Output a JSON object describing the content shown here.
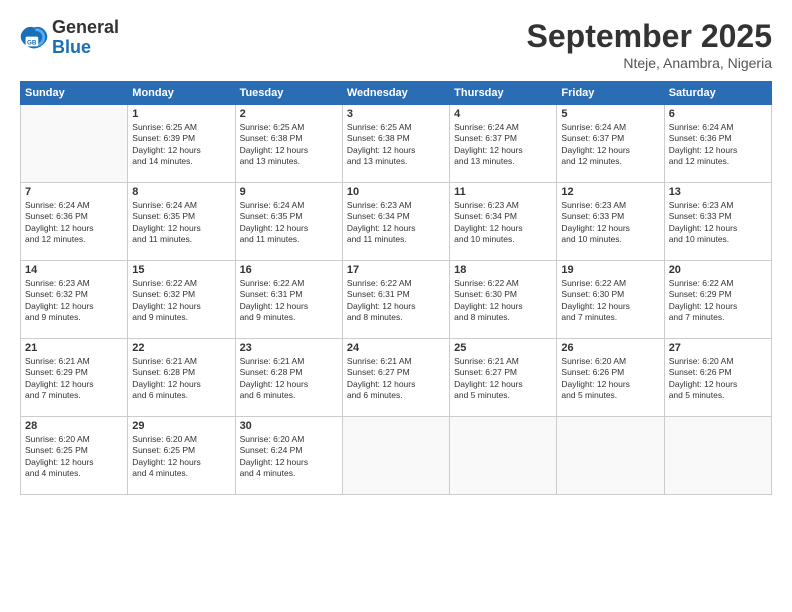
{
  "logo": {
    "text_general": "General",
    "text_blue": "Blue"
  },
  "title": "September 2025",
  "location": "Nteje, Anambra, Nigeria",
  "header_days": [
    "Sunday",
    "Monday",
    "Tuesday",
    "Wednesday",
    "Thursday",
    "Friday",
    "Saturday"
  ],
  "weeks": [
    [
      {
        "day": "",
        "info": ""
      },
      {
        "day": "1",
        "info": "Sunrise: 6:25 AM\nSunset: 6:39 PM\nDaylight: 12 hours\nand 14 minutes."
      },
      {
        "day": "2",
        "info": "Sunrise: 6:25 AM\nSunset: 6:38 PM\nDaylight: 12 hours\nand 13 minutes."
      },
      {
        "day": "3",
        "info": "Sunrise: 6:25 AM\nSunset: 6:38 PM\nDaylight: 12 hours\nand 13 minutes."
      },
      {
        "day": "4",
        "info": "Sunrise: 6:24 AM\nSunset: 6:37 PM\nDaylight: 12 hours\nand 13 minutes."
      },
      {
        "day": "5",
        "info": "Sunrise: 6:24 AM\nSunset: 6:37 PM\nDaylight: 12 hours\nand 12 minutes."
      },
      {
        "day": "6",
        "info": "Sunrise: 6:24 AM\nSunset: 6:36 PM\nDaylight: 12 hours\nand 12 minutes."
      }
    ],
    [
      {
        "day": "7",
        "info": "Sunrise: 6:24 AM\nSunset: 6:36 PM\nDaylight: 12 hours\nand 12 minutes."
      },
      {
        "day": "8",
        "info": "Sunrise: 6:24 AM\nSunset: 6:35 PM\nDaylight: 12 hours\nand 11 minutes."
      },
      {
        "day": "9",
        "info": "Sunrise: 6:24 AM\nSunset: 6:35 PM\nDaylight: 12 hours\nand 11 minutes."
      },
      {
        "day": "10",
        "info": "Sunrise: 6:23 AM\nSunset: 6:34 PM\nDaylight: 12 hours\nand 11 minutes."
      },
      {
        "day": "11",
        "info": "Sunrise: 6:23 AM\nSunset: 6:34 PM\nDaylight: 12 hours\nand 10 minutes."
      },
      {
        "day": "12",
        "info": "Sunrise: 6:23 AM\nSunset: 6:33 PM\nDaylight: 12 hours\nand 10 minutes."
      },
      {
        "day": "13",
        "info": "Sunrise: 6:23 AM\nSunset: 6:33 PM\nDaylight: 12 hours\nand 10 minutes."
      }
    ],
    [
      {
        "day": "14",
        "info": "Sunrise: 6:23 AM\nSunset: 6:32 PM\nDaylight: 12 hours\nand 9 minutes."
      },
      {
        "day": "15",
        "info": "Sunrise: 6:22 AM\nSunset: 6:32 PM\nDaylight: 12 hours\nand 9 minutes."
      },
      {
        "day": "16",
        "info": "Sunrise: 6:22 AM\nSunset: 6:31 PM\nDaylight: 12 hours\nand 9 minutes."
      },
      {
        "day": "17",
        "info": "Sunrise: 6:22 AM\nSunset: 6:31 PM\nDaylight: 12 hours\nand 8 minutes."
      },
      {
        "day": "18",
        "info": "Sunrise: 6:22 AM\nSunset: 6:30 PM\nDaylight: 12 hours\nand 8 minutes."
      },
      {
        "day": "19",
        "info": "Sunrise: 6:22 AM\nSunset: 6:30 PM\nDaylight: 12 hours\nand 7 minutes."
      },
      {
        "day": "20",
        "info": "Sunrise: 6:22 AM\nSunset: 6:29 PM\nDaylight: 12 hours\nand 7 minutes."
      }
    ],
    [
      {
        "day": "21",
        "info": "Sunrise: 6:21 AM\nSunset: 6:29 PM\nDaylight: 12 hours\nand 7 minutes."
      },
      {
        "day": "22",
        "info": "Sunrise: 6:21 AM\nSunset: 6:28 PM\nDaylight: 12 hours\nand 6 minutes."
      },
      {
        "day": "23",
        "info": "Sunrise: 6:21 AM\nSunset: 6:28 PM\nDaylight: 12 hours\nand 6 minutes."
      },
      {
        "day": "24",
        "info": "Sunrise: 6:21 AM\nSunset: 6:27 PM\nDaylight: 12 hours\nand 6 minutes."
      },
      {
        "day": "25",
        "info": "Sunrise: 6:21 AM\nSunset: 6:27 PM\nDaylight: 12 hours\nand 5 minutes."
      },
      {
        "day": "26",
        "info": "Sunrise: 6:20 AM\nSunset: 6:26 PM\nDaylight: 12 hours\nand 5 minutes."
      },
      {
        "day": "27",
        "info": "Sunrise: 6:20 AM\nSunset: 6:26 PM\nDaylight: 12 hours\nand 5 minutes."
      }
    ],
    [
      {
        "day": "28",
        "info": "Sunrise: 6:20 AM\nSunset: 6:25 PM\nDaylight: 12 hours\nand 4 minutes."
      },
      {
        "day": "29",
        "info": "Sunrise: 6:20 AM\nSunset: 6:25 PM\nDaylight: 12 hours\nand 4 minutes."
      },
      {
        "day": "30",
        "info": "Sunrise: 6:20 AM\nSunset: 6:24 PM\nDaylight: 12 hours\nand 4 minutes."
      },
      {
        "day": "",
        "info": ""
      },
      {
        "day": "",
        "info": ""
      },
      {
        "day": "",
        "info": ""
      },
      {
        "day": "",
        "info": ""
      }
    ]
  ]
}
